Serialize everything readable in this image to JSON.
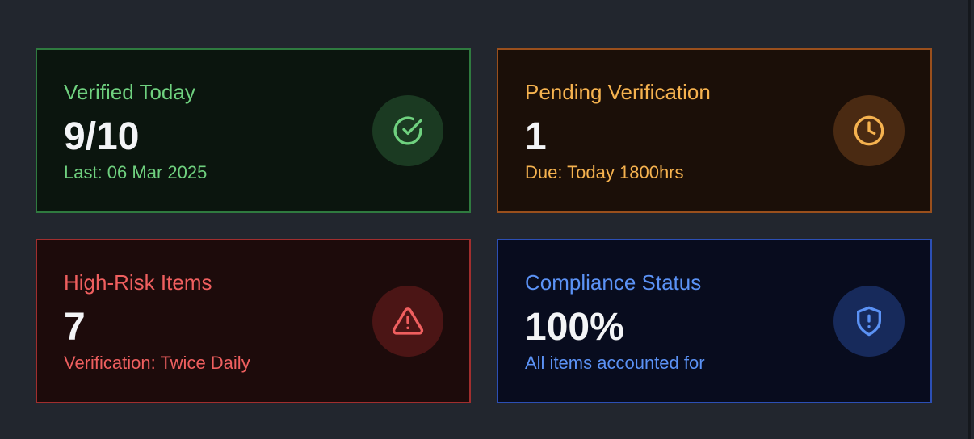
{
  "cards": [
    {
      "title": "Verified Today",
      "value": "9/10",
      "subtitle": "Last: 06 Mar 2025",
      "icon": "check-circle-icon",
      "accent": "#6fd17f",
      "border": "#2f7a3f",
      "background": "#0b150e",
      "icon_bg": "#1b3a22"
    },
    {
      "title": "Pending Verification",
      "value": "1",
      "subtitle": "Due: Today 1800hrs",
      "icon": "clock-icon",
      "accent": "#f5b24f",
      "border": "#9a4f1c",
      "background": "#1b0f08",
      "icon_bg": "#4a2a12"
    },
    {
      "title": "High-Risk Items",
      "value": "7",
      "subtitle": "Verification: Twice Daily",
      "icon": "warning-triangle-icon",
      "accent": "#ef5f5f",
      "border": "#a12e2e",
      "background": "#1d0b0b",
      "icon_bg": "#4b1515"
    },
    {
      "title": "Compliance Status",
      "value": "100%",
      "subtitle": "All items accounted for",
      "icon": "shield-alert-icon",
      "accent": "#5b92f5",
      "border": "#2c4fb5",
      "background": "#080c1e",
      "icon_bg": "#172a5b"
    }
  ]
}
